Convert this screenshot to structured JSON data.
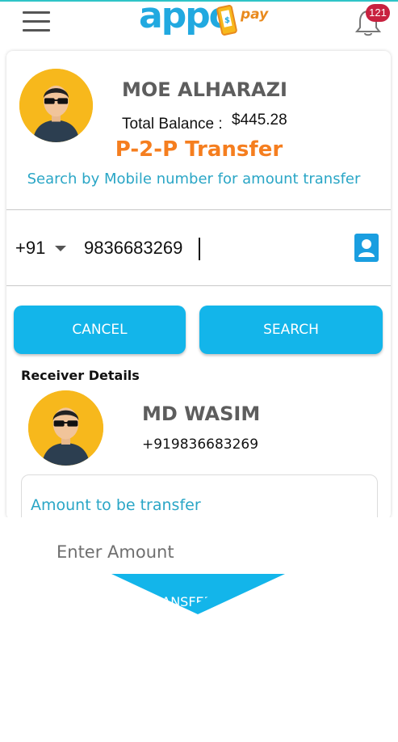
{
  "header": {
    "logo_text": "appo",
    "logo_sub": "pay",
    "notification_count": "121"
  },
  "profile": {
    "name": "MOE ALHARAZI",
    "balance_label": "Total Balance :",
    "balance_amount": "$445.28"
  },
  "p2p": {
    "title": "P-2-P Transfer",
    "subtitle": "Search by Mobile number for amount transfer",
    "country_code": "+91",
    "phone_value": "9836683269"
  },
  "buttons": {
    "cancel": "CANCEL",
    "search": "SEARCH",
    "transfer": "TRANSFER"
  },
  "receiver": {
    "section_title": "Receiver Details",
    "name": "MD WASIM",
    "phone": "+919836683269"
  },
  "amount": {
    "label": "Amount to be transfer",
    "placeholder": "Enter Amount"
  },
  "colors": {
    "accent_blue": "#13b5ea",
    "orange": "#f57e1f",
    "teal_text": "#2aa6c6",
    "badge_red": "#c8213f"
  }
}
